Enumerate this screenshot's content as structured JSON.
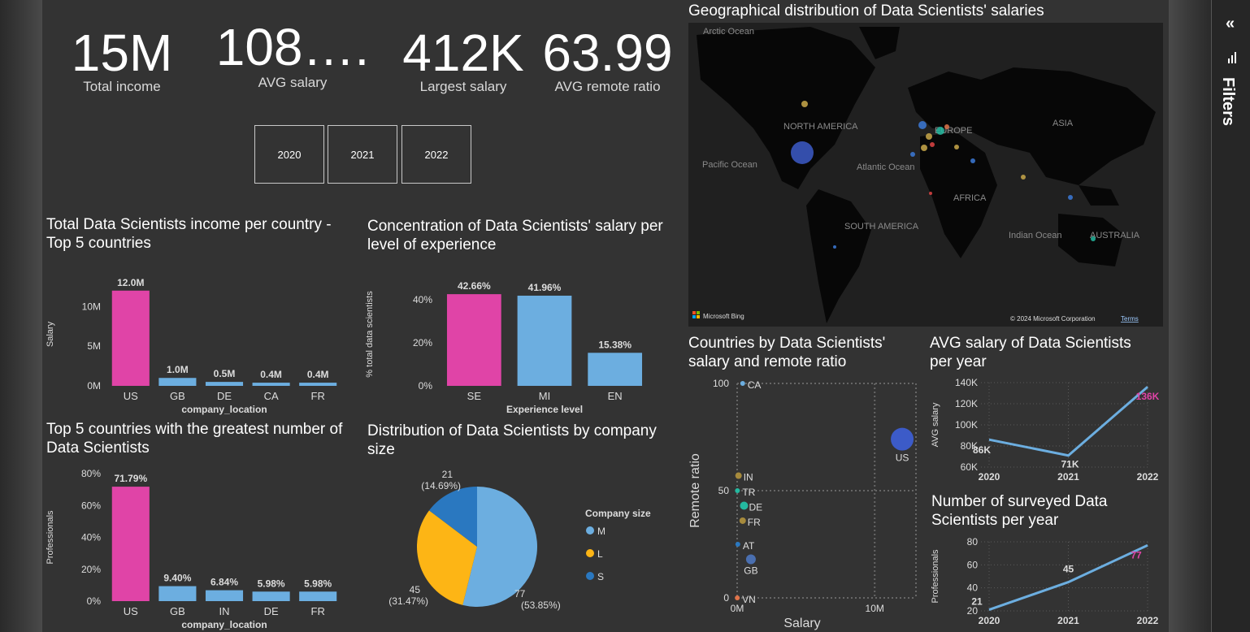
{
  "kpis": [
    {
      "value": "15M",
      "label": "Total income"
    },
    {
      "value": "108….",
      "label": "AVG salary"
    },
    {
      "value": "412K",
      "label": "Largest salary"
    },
    {
      "value": "63.99",
      "label": "AVG remote ratio"
    }
  ],
  "year_slicer": {
    "options": [
      "2020",
      "2021",
      "2022"
    ]
  },
  "colors": {
    "pink": "#e044a7",
    "blue": "#6caee0",
    "yellow": "#fdb515",
    "darkblue": "#2a78c0"
  },
  "chart_data": [
    {
      "id": "income_per_country",
      "type": "bar",
      "title": "Total Data Scientists income per country - Top 5 countries",
      "categories": [
        "US",
        "GB",
        "DE",
        "CA",
        "FR"
      ],
      "values": [
        12.0,
        1.0,
        0.5,
        0.4,
        0.4
      ],
      "data_labels": [
        "12.0M",
        "1.0M",
        "0.5M",
        "0.4M",
        "0.4M"
      ],
      "xlabel": "company_location",
      "ylabel": "Salary",
      "yticks": [
        "0M",
        "5M",
        "10M"
      ],
      "ylim": [
        0,
        13
      ]
    },
    {
      "id": "salary_by_experience",
      "type": "bar",
      "title": "Concentration of Data Scientists' salary per level of experience",
      "categories": [
        "SE",
        "MI",
        "EN"
      ],
      "values": [
        42.66,
        41.96,
        15.38
      ],
      "data_labels": [
        "42.66%",
        "41.96%",
        "15.38%"
      ],
      "xlabel": "Experience level",
      "ylabel": "% total data scientists",
      "yticks": [
        "0%",
        "20%",
        "40%"
      ],
      "ylim": [
        0,
        48
      ]
    },
    {
      "id": "count_per_country",
      "type": "bar",
      "title": "Top 5 countries with the greatest number of Data Scientists",
      "categories": [
        "US",
        "GB",
        "IN",
        "DE",
        "FR"
      ],
      "values": [
        71.79,
        9.4,
        6.84,
        5.98,
        5.98
      ],
      "data_labels": [
        "71.79%",
        "9.40%",
        "6.84%",
        "5.98%",
        "5.98%"
      ],
      "xlabel": "company_location",
      "ylabel": "Professionals",
      "yticks": [
        "0%",
        "20%",
        "40%",
        "60%",
        "80%"
      ],
      "ylim": [
        0,
        80
      ]
    },
    {
      "id": "company_size",
      "type": "pie",
      "title": "Distribution of Data Scientists by company size",
      "legend_title": "Company size",
      "slices": [
        {
          "name": "M",
          "value": 77,
          "pct": "(53.85%)"
        },
        {
          "name": "L",
          "value": 45,
          "pct": "(31.47%)"
        },
        {
          "name": "S",
          "value": 21,
          "pct": "(14.69%)"
        }
      ]
    },
    {
      "id": "remote_scatter",
      "type": "scatter",
      "title": "Countries by Data Scientists' salary and remote ratio",
      "xlabel": "Salary",
      "ylabel": "Remote ratio",
      "xticks": [
        "0M",
        "10M"
      ],
      "yticks": [
        "0",
        "50",
        "100"
      ],
      "xlim": [
        0,
        13
      ],
      "ylim": [
        0,
        100
      ],
      "points": [
        {
          "label": "US",
          "x": 12.0,
          "y": 74,
          "size": 14,
          "color": "#3c5bc8"
        },
        {
          "label": "CA",
          "x": 0.4,
          "y": 100,
          "size": 3,
          "color": "#6caee0"
        },
        {
          "label": "IN",
          "x": 0.1,
          "y": 57,
          "size": 4,
          "color": "#a68a3c"
        },
        {
          "label": "TR",
          "x": 0.02,
          "y": 50,
          "size": 3,
          "color": "#24b9a0"
        },
        {
          "label": "DE",
          "x": 0.5,
          "y": 43,
          "size": 5,
          "color": "#24b9a0"
        },
        {
          "label": "FR",
          "x": 0.4,
          "y": 36,
          "size": 4,
          "color": "#a68a3c"
        },
        {
          "label": "AT",
          "x": 0.05,
          "y": 25,
          "size": 3,
          "color": "#2a78c0"
        },
        {
          "label": "GB",
          "x": 1.0,
          "y": 18,
          "size": 6,
          "color": "#4a6fb0"
        },
        {
          "label": "VN",
          "x": 0.01,
          "y": 0,
          "size": 3,
          "color": "#e0744a"
        }
      ]
    },
    {
      "id": "avg_salary_year",
      "type": "line",
      "title": "AVG salary of Data Scientists per year",
      "x": [
        "2020",
        "2021",
        "2022"
      ],
      "values": [
        86,
        71,
        136
      ],
      "data_labels": [
        "86K",
        "71K",
        "136K"
      ],
      "ylabel": "AVG salary",
      "yticks": [
        "60K",
        "80K",
        "100K",
        "120K",
        "140K"
      ],
      "ylim": [
        60,
        140
      ]
    },
    {
      "id": "surveyed_year",
      "type": "line",
      "title": "Number of surveyed Data Scientists per year",
      "x": [
        "2020",
        "2021",
        "2022"
      ],
      "values": [
        21,
        45,
        77
      ],
      "data_labels": [
        "21",
        "45",
        "77"
      ],
      "ylabel": "Professionals",
      "yticks": [
        "20",
        "40",
        "60",
        "80"
      ],
      "ylim": [
        20,
        80
      ]
    }
  ],
  "map": {
    "title": "Geographical distribution of Data Scientists' salaries",
    "labels": [
      "Arctic Ocean",
      "NORTH AMERICA",
      "EUROPE",
      "ASIA",
      "Pacific Ocean",
      "Atlantic Ocean",
      "AFRICA",
      "SOUTH AMERICA",
      "Indian Ocean",
      "AUSTRALIA"
    ],
    "bing": "Microsoft Bing",
    "copyright": "© 2024 Microsoft Corporation",
    "terms": "Terms"
  },
  "filters": {
    "label": "Filters",
    "collapse_icon": "«"
  }
}
